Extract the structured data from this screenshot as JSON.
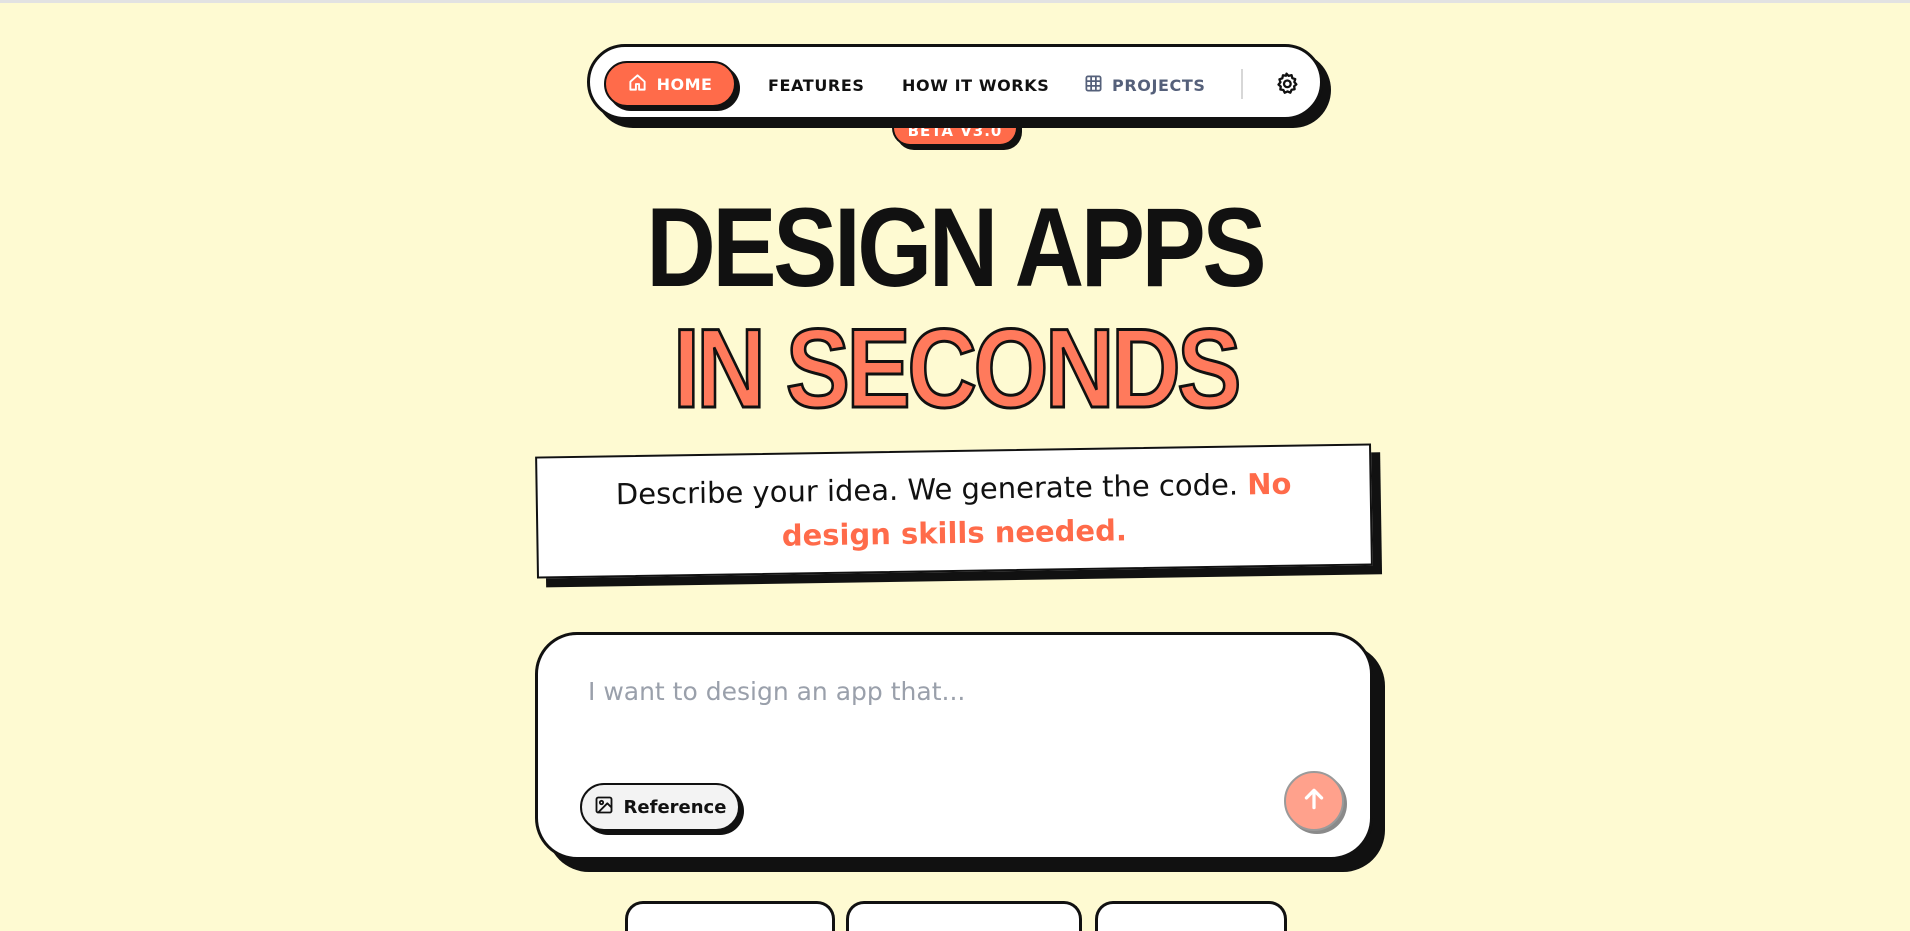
{
  "nav": {
    "home_label": "HOME",
    "features_label": "FEATURES",
    "how_label": "HOW IT WORKS",
    "projects_label": "PROJECTS"
  },
  "badge": "BETA V3.0",
  "hero": {
    "line1": "DESIGN APPS",
    "line2": "IN SECONDS"
  },
  "tagline": {
    "text": "Describe your idea. We generate the code. ",
    "accent": "No design skills needed."
  },
  "prompt": {
    "placeholder": "I want to design an app that...",
    "reference_label": "Reference"
  },
  "colors": {
    "background": "#FEFAD2",
    "accent": "#FF6B4A",
    "ink": "#111111"
  },
  "icons": {
    "home": "home-icon",
    "projects": "grid-icon",
    "settings": "gear-icon",
    "reference": "image-icon",
    "send": "arrow-up-icon"
  }
}
